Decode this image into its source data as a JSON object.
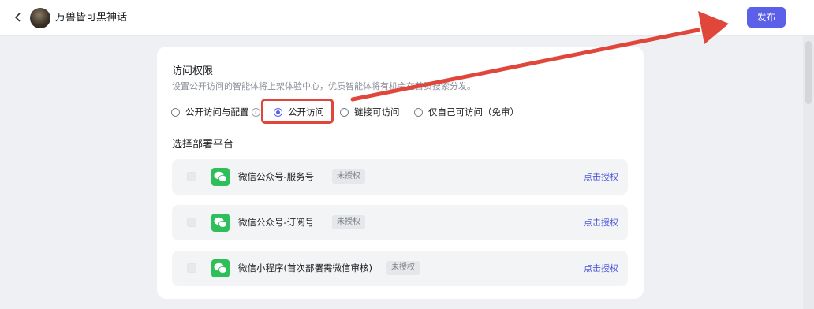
{
  "header": {
    "back_icon": "chevron-left-icon",
    "title": "万兽皆可黑神话",
    "publish_label": "发布"
  },
  "access": {
    "title": "访问权限",
    "description": "设置公开访问的智能体将上架体验中心，优质智能体将有机会在首页搜索分发。",
    "options": [
      {
        "label": "公开访问与配置",
        "selected": false,
        "has_info_icon": true
      },
      {
        "label": "公开访问",
        "selected": true
      },
      {
        "label": "链接可访问",
        "selected": false
      },
      {
        "label": "仅自己可访问（免审）",
        "selected": false
      }
    ]
  },
  "deploy": {
    "title": "选择部署平台",
    "platforms": [
      {
        "name": "微信公众号-服务号",
        "status": "未授权",
        "action": "点击授权",
        "checked": false
      },
      {
        "name": "微信公众号-订阅号",
        "status": "未授权",
        "action": "点击授权",
        "checked": false
      },
      {
        "name": "微信小程序(首次部署需微信审核)",
        "status": "未授权",
        "action": "点击授权",
        "checked": false
      }
    ]
  },
  "colors": {
    "accent": "#5a60e8",
    "annotation_red": "#e0463a",
    "wechat_green": "#2fbf5a"
  }
}
